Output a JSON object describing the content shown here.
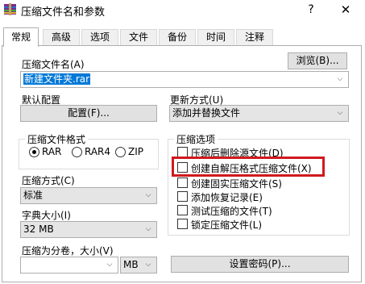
{
  "window": {
    "title": "压缩文件名和参数",
    "help_label": "?",
    "close_label": "✕"
  },
  "tabs": [
    {
      "label": "常规",
      "active": true
    },
    {
      "label": "高级"
    },
    {
      "label": "选项"
    },
    {
      "label": "文件"
    },
    {
      "label": "备份"
    },
    {
      "label": "时间"
    },
    {
      "label": "注释"
    }
  ],
  "archive_name": {
    "label": "压缩文件名(A)",
    "browse_label": "浏览(B)...",
    "value": "新建文件夹.rar"
  },
  "profiles": {
    "label": "默认配置",
    "button_label": "配置(F)..."
  },
  "update_mode": {
    "label": "更新方式(U)",
    "value": "添加并替换文件"
  },
  "archive_format": {
    "label": "压缩文件格式",
    "options": [
      {
        "label": "RAR",
        "selected": true
      },
      {
        "label": "RAR4",
        "selected": false
      },
      {
        "label": "ZIP",
        "selected": false
      }
    ]
  },
  "compression_method": {
    "label": "压缩方式(C)",
    "value": "标准"
  },
  "dictionary_size": {
    "label": "字典大小(I)",
    "value": "32 MB"
  },
  "split_volumes": {
    "label": "压缩为分卷，大小(V)",
    "value": "",
    "unit": "MB"
  },
  "archive_options": {
    "label": "压缩选项",
    "items": [
      {
        "label": "压缩后删除源文件(D)",
        "checked": false
      },
      {
        "label": "创建自解压格式压缩文件(X)",
        "checked": false,
        "highlighted": true
      },
      {
        "label": "创建固实压缩文件(S)",
        "checked": false
      },
      {
        "label": "添加恢复记录(E)",
        "checked": false
      },
      {
        "label": "测试压缩的文件(T)",
        "checked": false
      },
      {
        "label": "锁定压缩文件(L)",
        "checked": false
      }
    ]
  },
  "password": {
    "button_label": "设置密码(P)..."
  },
  "colors": {
    "highlight_box": "#d0191e",
    "selection": "#0078d7"
  }
}
